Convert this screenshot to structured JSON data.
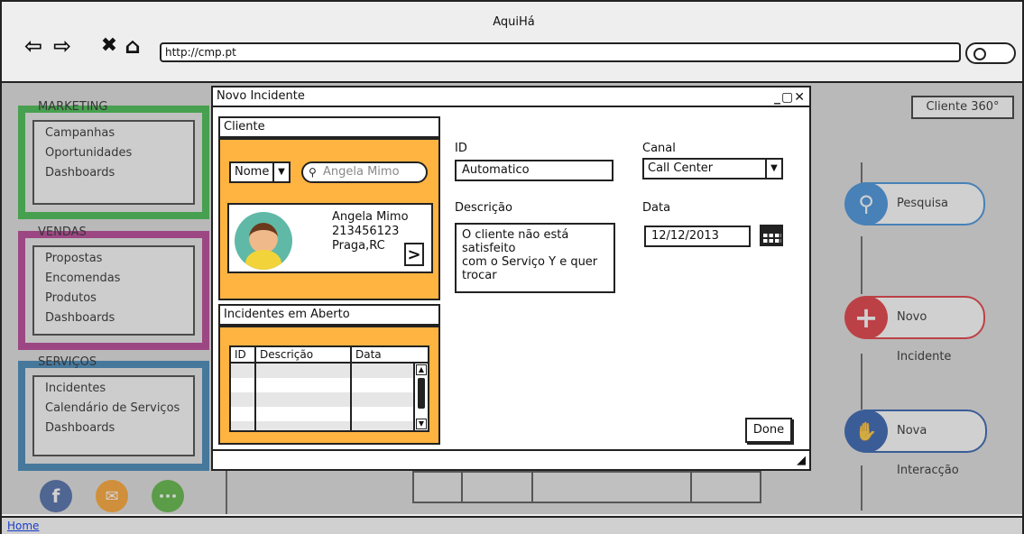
{
  "browser": {
    "title": "AquiHá",
    "url": "http://cmp.pt",
    "status_link": "Home"
  },
  "sidebar": {
    "marketing": {
      "title": "MARKETING",
      "color": "#2db53a",
      "items": [
        "Campanhas",
        "Oportunidades",
        "Dashboards"
      ]
    },
    "vendas": {
      "title": "VENDAS",
      "color": "#b02d8a",
      "items": [
        "Propostas",
        "Encomendas",
        "Produtos",
        "Dashboards"
      ]
    },
    "servicos": {
      "title": "SERVIÇOS",
      "color": "#2b79b0",
      "items": [
        "Incidentes",
        "Calendário de Serviços",
        "Dashboards"
      ]
    }
  },
  "right": {
    "cliente360": "Cliente 360°",
    "cards": [
      {
        "label": "Pesquisa",
        "color": "#2d86d9",
        "icon": "search-icon"
      },
      {
        "label": "Novo Incidente",
        "color": "#e0242c",
        "icon": "plus-icon"
      },
      {
        "label": "Nova Interacção",
        "color": "#1b4fa8",
        "icon": "handshake-icon"
      }
    ]
  },
  "social": [
    {
      "icon": "facebook-icon",
      "color": "#3a5ba0",
      "glyph": "f"
    },
    {
      "icon": "mail-icon",
      "color": "#ff9b1a",
      "glyph": "✉"
    },
    {
      "icon": "chat-icon",
      "color": "#4caf2f",
      "glyph": "•••"
    }
  ],
  "modal": {
    "title": "Novo Incidente",
    "controls": "_▢✕",
    "cliente": {
      "header": "Cliente",
      "field_select": "Nome",
      "search_placeholder": "Angela Mimo",
      "profile": {
        "name": "Angela Mimo",
        "phone": "213456123",
        "location": "Praga,RC"
      }
    },
    "incidentes": {
      "header": "Incidentes em Aberto",
      "columns": [
        "ID",
        "Descrição",
        "Data"
      ]
    },
    "form": {
      "id_label": "ID",
      "id_value": "Automatico",
      "canal_label": "Canal",
      "canal_value": "Call Center",
      "descricao_label": "Descrição",
      "descricao_lines": [
        "O cliente não está",
        "satisfeito",
        "com o Serviço Y e quer",
        "trocar"
      ],
      "data_label": "Data",
      "data_value": "12/12/2013"
    },
    "done_label": "Done"
  }
}
